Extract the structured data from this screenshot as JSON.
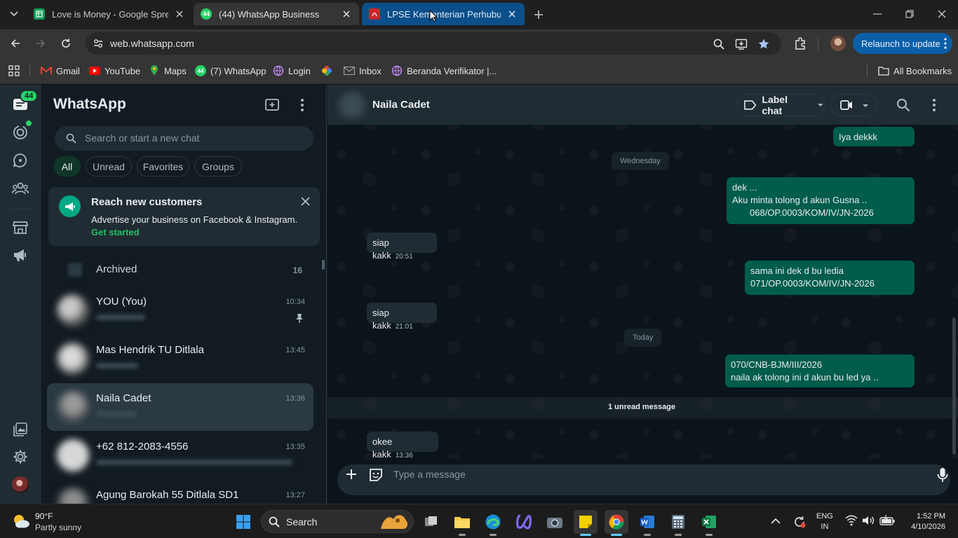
{
  "browser": {
    "tabs": [
      {
        "title": "Love is Money - Google Spreadsheet",
        "favicon": "sheets-icon"
      },
      {
        "title": "(44) WhatsApp Business",
        "favicon_text": "44"
      },
      {
        "title": "LPSE Kementerian Perhubungan",
        "favicon": "pdf-icon"
      }
    ],
    "url": "web.whatsapp.com",
    "relaunch_label": "Relaunch to update",
    "bookmarks": [
      {
        "label": "Gmail"
      },
      {
        "label": "YouTube"
      },
      {
        "label": "Maps"
      },
      {
        "label": "(7) WhatsApp",
        "icon_text": "44"
      },
      {
        "label": "Login"
      },
      {
        "label": "Inbox"
      },
      {
        "label": "Beranda Verifikator |..."
      }
    ],
    "all_bookmarks_label": "All Bookmarks"
  },
  "rail": {
    "chats_badge": "44"
  },
  "sidebar": {
    "title": "WhatsApp",
    "search_placeholder": "Search or start a new chat",
    "filters": [
      "All",
      "Unread",
      "Favorites",
      "Groups"
    ],
    "promo": {
      "title": "Reach new customers",
      "text": "Advertise your business on Facebook & Instagram.",
      "link": "Get started"
    },
    "archived": {
      "label": "Archived",
      "count": "16"
    },
    "chats": [
      {
        "name": "YOU (You)",
        "time": "10:34",
        "pinned": true
      },
      {
        "name": "Mas Hendrik TU Ditlala",
        "time": "13:45"
      },
      {
        "name": "Naila Cadet",
        "time": "13:36",
        "selected": true
      },
      {
        "name": "+62 812-2083-4556",
        "time": "13:35"
      },
      {
        "name": "Agung Barokah 55 Ditlala SD1",
        "time": "13:27"
      }
    ]
  },
  "chat": {
    "contact_name": "Naila Cadet",
    "label_chat": "Label chat",
    "composer_placeholder": "Type a message",
    "day_wednesday": "Wednesday",
    "day_today": "Today",
    "unread_label": "1 unread message",
    "messages": {
      "m0": {
        "text": "Iya dekkk"
      },
      "m1": {
        "l1": "dek ...",
        "l2": "Aku minta tolong d akun Gusna ..",
        "l3": "068/OP.0003/KOM/IV/JN-2026"
      },
      "m2": {
        "text": "siap kakk",
        "time": "20:51"
      },
      "m3": {
        "l1": "sama ini dek d bu ledia",
        "l2": "071/OP.0003/KOM/IV/JN-2026"
      },
      "m4": {
        "text": "siap kakk",
        "time": "21:01"
      },
      "m5": {
        "l1": "070/CNB-BJM/III/2026",
        "l2": "naila ak tolong ini d akun bu led ya .."
      },
      "m6": {
        "text": "okee kakk",
        "time": "13:36"
      }
    }
  },
  "taskbar": {
    "weather_temp": "90°F",
    "weather_cond": "Partly sunny",
    "search_label": "Search",
    "lang_1": "ENG",
    "lang_2": "IN",
    "time": "1:52 PM",
    "date": "4/10/2026"
  },
  "colors": {
    "accent_green": "#00a884",
    "outgoing_bubble": "#005c4b",
    "incoming_bubble": "#202c33",
    "relaunch_blue": "#0b5fa8"
  }
}
